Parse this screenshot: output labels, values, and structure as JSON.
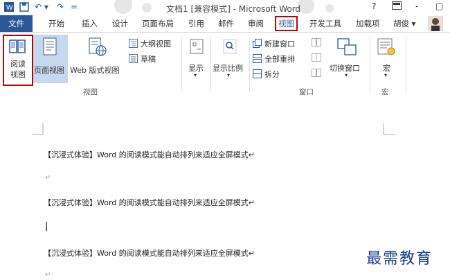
{
  "window": {
    "title": "文档1 [兼容模式] - Microsoft Word",
    "help": "?",
    "minimize": "-",
    "maximize": "□"
  },
  "qat": {
    "undo": "↶ ▾",
    "redo": "↷",
    "more": "="
  },
  "tabs": {
    "file": "文件",
    "items": [
      "开始",
      "插入",
      "设计",
      "页面布局",
      "引用",
      "邮件",
      "审阅",
      "视图",
      "开发工具",
      "加载项"
    ],
    "active": "视图",
    "user": "胡俊 ▾"
  },
  "ribbon": {
    "views": {
      "read_mode": [
        "阅读",
        "视图"
      ],
      "print_layout": "页面视图",
      "web_layout": "Web 版式视图",
      "outline": "大纲视图",
      "draft": "草稿",
      "group_label": "视图"
    },
    "show": {
      "label": "显示",
      "arrow": "▾"
    },
    "zoom": {
      "label": "显示比例",
      "arrow": "▾"
    },
    "window": {
      "new_window": "新建窗口",
      "arrange_all": "全部重排",
      "split": "拆分",
      "switch_windows": "切换窗口",
      "arrow": "▾",
      "group_label": "窗口"
    },
    "macros": {
      "label": "宏",
      "arrow": "▾",
      "group_label": "宏"
    }
  },
  "document": {
    "lines": [
      "【沉浸式体验】Word 的阅读模式能自动排列来适应全屏模式↵",
      "【沉浸式体验】Word 的阅读模式能自动排列来适应全屏模式↵",
      "【沉浸式体验】Word 的阅读模式能自动排列来适应全屏模式↵"
    ],
    "para_mark": "↵",
    "cursor": "|"
  },
  "watermark": "最需教育",
  "colors": {
    "accent": "#2b579a",
    "highlight": "#c00000"
  }
}
